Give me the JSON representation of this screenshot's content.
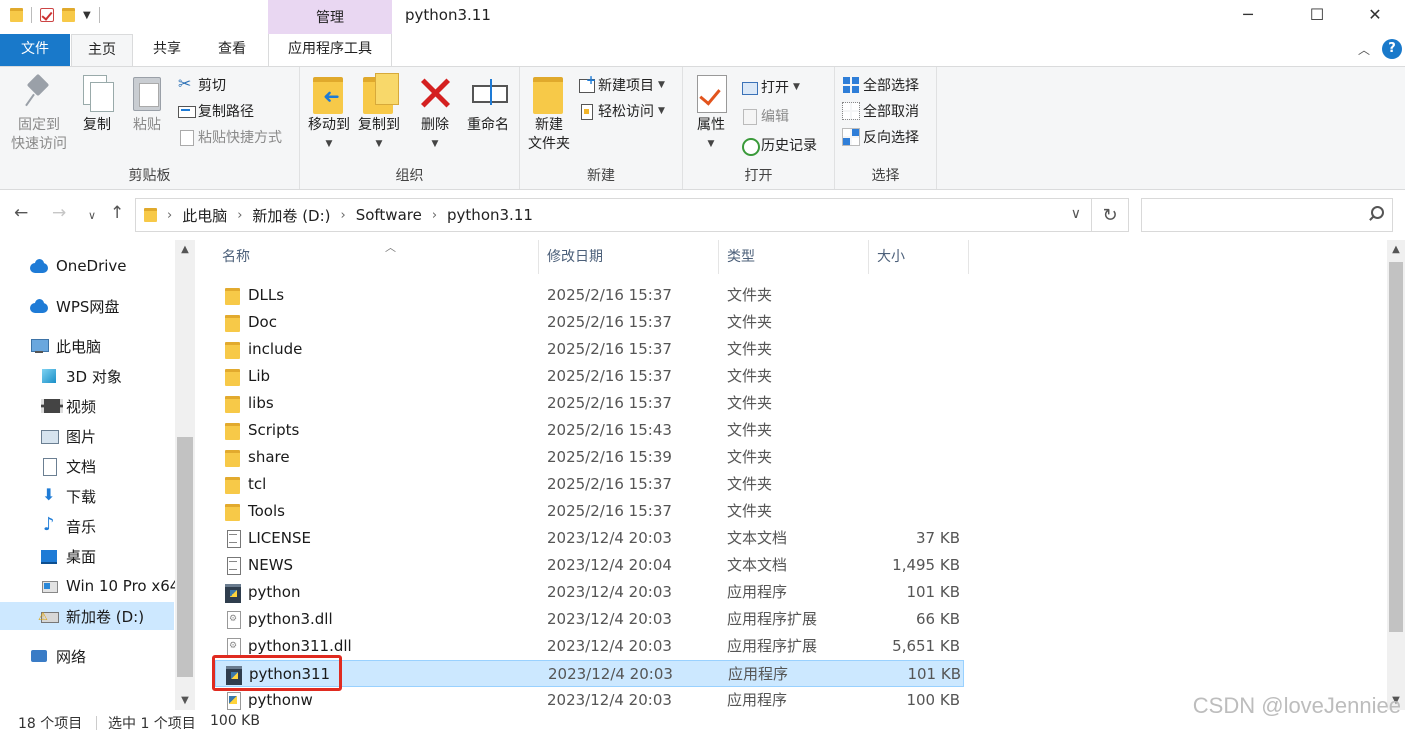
{
  "window": {
    "title": "python3.11",
    "contextual_tab": "管理",
    "controls": [
      "─",
      "☐",
      "✕"
    ]
  },
  "tabs": {
    "file": "文件",
    "home": "主页",
    "share": "共享",
    "view": "查看",
    "app_tools": "应用程序工具"
  },
  "ribbon": {
    "clipboard": {
      "label": "剪贴板",
      "pin_line1": "固定到",
      "pin_line2": "快速访问",
      "copy": "复制",
      "paste": "粘贴",
      "cut": "剪切",
      "copy_path": "复制路径",
      "paste_shortcut": "粘贴快捷方式"
    },
    "organize": {
      "label": "组织",
      "move_to": "移动到",
      "copy_to": "复制到",
      "delete": "删除",
      "rename": "重命名"
    },
    "new": {
      "label": "新建",
      "new_folder_line1": "新建",
      "new_folder_line2": "文件夹",
      "new_item": "新建项目",
      "easy_access": "轻松访问"
    },
    "open": {
      "label": "打开",
      "properties": "属性",
      "open": "打开",
      "edit": "编辑",
      "history": "历史记录"
    },
    "select": {
      "label": "选择",
      "select_all": "全部选择",
      "select_none": "全部取消",
      "invert": "反向选择"
    }
  },
  "address": {
    "crumbs": [
      "此电脑",
      "新加卷 (D:)",
      "Software",
      "python3.11"
    ]
  },
  "search": {
    "placeholder": ""
  },
  "nav": {
    "onedrive": "OneDrive",
    "wps": "WPS网盘",
    "this_pc": "此电脑",
    "objects3d": "3D 对象",
    "videos": "视频",
    "pictures": "图片",
    "documents": "文档",
    "downloads": "下载",
    "music": "音乐",
    "desktop": "桌面",
    "win10": "Win 10 Pro x64",
    "drive_d": "新加卷 (D:)",
    "network": "网络"
  },
  "columns": {
    "name": "名称",
    "date": "修改日期",
    "type": "类型",
    "size": "大小"
  },
  "files": [
    {
      "name": "DLLs",
      "date": "2025/2/16 15:37",
      "type": "文件夹",
      "size": "",
      "icon": "folder-icon"
    },
    {
      "name": "Doc",
      "date": "2025/2/16 15:37",
      "type": "文件夹",
      "size": "",
      "icon": "folder-icon"
    },
    {
      "name": "include",
      "date": "2025/2/16 15:37",
      "type": "文件夹",
      "size": "",
      "icon": "folder-icon"
    },
    {
      "name": "Lib",
      "date": "2025/2/16 15:37",
      "type": "文件夹",
      "size": "",
      "icon": "folder-icon"
    },
    {
      "name": "libs",
      "date": "2025/2/16 15:37",
      "type": "文件夹",
      "size": "",
      "icon": "folder-icon"
    },
    {
      "name": "Scripts",
      "date": "2025/2/16 15:43",
      "type": "文件夹",
      "size": "",
      "icon": "folder-icon"
    },
    {
      "name": "share",
      "date": "2025/2/16 15:39",
      "type": "文件夹",
      "size": "",
      "icon": "folder-icon"
    },
    {
      "name": "tcl",
      "date": "2025/2/16 15:37",
      "type": "文件夹",
      "size": "",
      "icon": "folder-icon"
    },
    {
      "name": "Tools",
      "date": "2025/2/16 15:37",
      "type": "文件夹",
      "size": "",
      "icon": "folder-icon"
    },
    {
      "name": "LICENSE",
      "date": "2023/12/4 20:03",
      "type": "文本文档",
      "size": "37 KB",
      "icon": "text-file-icon"
    },
    {
      "name": "NEWS",
      "date": "2023/12/4 20:04",
      "type": "文本文档",
      "size": "1,495 KB",
      "icon": "text-file-icon"
    },
    {
      "name": "python",
      "date": "2023/12/4 20:03",
      "type": "应用程序",
      "size": "101 KB",
      "icon": "python-app-icon"
    },
    {
      "name": "python3.dll",
      "date": "2023/12/4 20:03",
      "type": "应用程序扩展",
      "size": "66 KB",
      "icon": "dll-icon"
    },
    {
      "name": "python311.dll",
      "date": "2023/12/4 20:03",
      "type": "应用程序扩展",
      "size": "5,651 KB",
      "icon": "dll-icon"
    },
    {
      "name": "python311",
      "date": "2023/12/4 20:03",
      "type": "应用程序",
      "size": "101 KB",
      "icon": "python-app-icon",
      "selected": true
    },
    {
      "name": "pythonw",
      "date": "2023/12/4 20:03",
      "type": "应用程序",
      "size": "100 KB",
      "icon": "pythonw-app-icon"
    }
  ],
  "status": {
    "count": "18 个项目",
    "selection": "选中 1 个项目",
    "selection_size": "100 KB"
  },
  "watermark": "CSDN @loveJenniee",
  "colors": {
    "file_tab": "#1979ca",
    "contextual_tab": "#e9d7f2",
    "selection": "#cce8ff",
    "highlight_box": "#e02b20"
  }
}
